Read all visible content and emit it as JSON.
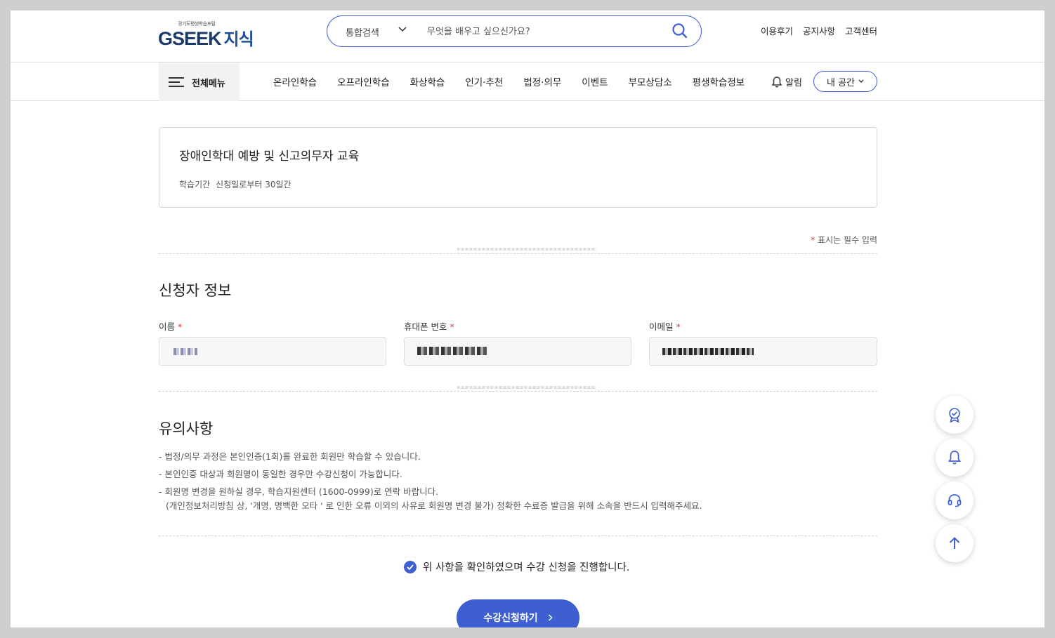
{
  "header": {
    "logo_small": "경기도평생학습포털",
    "logo_brand": "GSEEK",
    "logo_suffix": "지식",
    "search": {
      "category": "통합검색",
      "placeholder": "무엇을 배우고 싶으신가요?",
      "value": ""
    },
    "links": [
      "이용후기",
      "공지사항",
      "고객센터"
    ]
  },
  "nav": {
    "all_menu": "전체메뉴",
    "items": [
      "온라인학습",
      "오프라인학습",
      "화상학습",
      "인기·추천",
      "법정·의무",
      "이벤트",
      "부모상담소",
      "평생학습정보"
    ],
    "alarm": "알림",
    "my_space": "내 공간"
  },
  "course": {
    "title": "장애인학대 예방 및 신고의무자 교육",
    "period_label": "학습기간",
    "period_value": "신청일로부터 30일간"
  },
  "required_note": {
    "star": "*",
    "text": "표시는 필수 입력"
  },
  "applicant": {
    "heading": "신청자 정보",
    "fields": [
      {
        "label": "이름",
        "star": "*"
      },
      {
        "label": "휴대폰 번호",
        "star": "*"
      },
      {
        "label": "이메일",
        "star": "*"
      }
    ]
  },
  "notice": {
    "heading": "유의사항",
    "items": [
      "- 법정/의무 과정은 본인인증(1회)를 완료한 회원만 학습할 수 있습니다.",
      "- 본인인증 대상과 회원명이 동일한 경우만 수강신청이 가능합니다.",
      "- 회원명 변경을 원하실 경우, 학습지원센터 (1600-0999)로 연락 바랍니다."
    ],
    "sub": "(개인정보처리방침 상, '개명, 명백한 오타 ' 로 인한 오류 이외의 사유로 회원명 변경 불가) 정확한 수료증 발급을 위해 소속을 반드시 입력해주세요."
  },
  "agree_text": "위 사항을 확인하였으며 수강 신청을 진행합니다.",
  "submit_label": "수강신청하기",
  "colors": {
    "accent": "#3f5fd1",
    "required": "#e0302a"
  },
  "floating": [
    "certificate-icon",
    "bell-icon",
    "headset-icon",
    "arrow-up-icon"
  ]
}
